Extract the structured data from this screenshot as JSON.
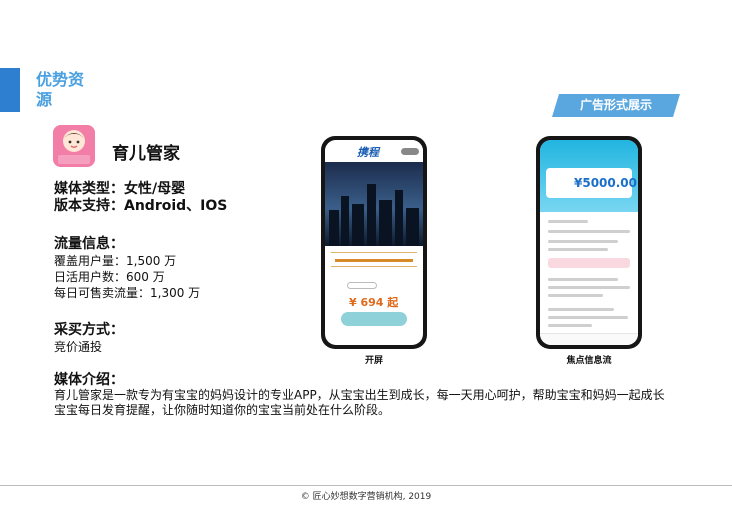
{
  "section": {
    "title": "优势资源"
  },
  "banner": {
    "label": "广告形式展示"
  },
  "app": {
    "name": "育儿管家",
    "icon": "baby-face-icon",
    "icon_label": "育儿管家"
  },
  "media": {
    "type": "媒体类型：女性/母婴",
    "platform": "版本支持：Android、IOS"
  },
  "traffic": {
    "title": "流量信息：",
    "lines": [
      "覆盖用户量：1,500 万",
      "日活用户数：600 万",
      "每日可售卖流量：1,300 万"
    ]
  },
  "purchase": {
    "title": "采买方式：",
    "value": "竞价通投"
  },
  "intro": {
    "title": "媒体介绍：",
    "lines": [
      "育儿管家是一款专为有宝宝的妈妈设计的专业APP，从宝宝出生到成长，每一天用心呵护，帮助宝宝和妈妈一起成长",
      "宝宝每日发育提醒，让你随时知道你的宝宝当前处在什么阶段。"
    ]
  },
  "phones": [
    {
      "label": "开屏",
      "logo": "携程",
      "price": "¥ 694 起"
    },
    {
      "label": "焦点信息流",
      "amount": "¥5000.00"
    }
  ],
  "footer": {
    "text": "© 匠心妙想数字营销机构, 2019"
  },
  "colors": {
    "accent": "#4aa0e0",
    "bar": "#2f7fd0",
    "icon_bg": "#f27ea8"
  }
}
